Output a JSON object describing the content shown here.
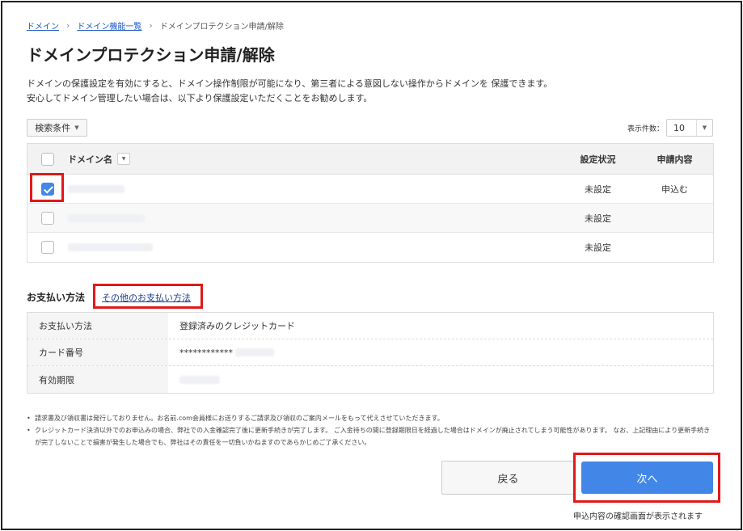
{
  "breadcrumb": {
    "items": [
      "ドメイン",
      "ドメイン機能一覧",
      "ドメインプロテクション申請/解除"
    ]
  },
  "page": {
    "title": "ドメインプロテクション申請/解除",
    "description_line1": "ドメインの保護設定を有効にすると、ドメイン操作制限が可能になり、第三者による意図しない操作からドメインを 保護できます。",
    "description_line2": "安心してドメイン管理したい場合は、以下より保護設定いただくことをお勧めします。"
  },
  "filter": {
    "label": "検索条件"
  },
  "per_page": {
    "label": "表示件数：",
    "value": "10"
  },
  "domain_table": {
    "columns": {
      "name": "ドメイン名",
      "status": "設定状況",
      "application": "申請内容"
    },
    "rows": [
      {
        "status": "未設定",
        "application": "申込む",
        "checked": true
      },
      {
        "status": "未設定",
        "application": "",
        "checked": false
      },
      {
        "status": "未設定",
        "application": "",
        "checked": false
      }
    ]
  },
  "payment": {
    "title": "お支払い方法",
    "other_link": "その他のお支払い方法",
    "rows": [
      {
        "label": "お支払い方法",
        "value": "登録済みのクレジットカード"
      },
      {
        "label": "カード番号",
        "value": "************"
      },
      {
        "label": "有効期限",
        "value": ""
      }
    ]
  },
  "notes": [
    "請求書及び領収書は発行しておりません。お名前.com会員様にお送りするご請求及び領収のご案内メールをもって代えさせていただきます。",
    "クレジットカード決済以外でのお申込みの場合、弊社での入金確認完了後に更新手続きが完了します。 ご入金待ちの間に登録期限日を経過した場合はドメインが廃止されてしまう可能性があります。 なお、上記理由により更新手続きが完了しないことで損害が発生した場合でも、弊社はその責任を一切負いかねますのであらかじめご了承ください。"
  ],
  "actions": {
    "back_label": "戻る",
    "next_label": "次へ",
    "next_hint": "申込内容の確認画面が表示されます"
  },
  "colors": {
    "accent": "#4287e8",
    "highlight": "#e01919"
  }
}
